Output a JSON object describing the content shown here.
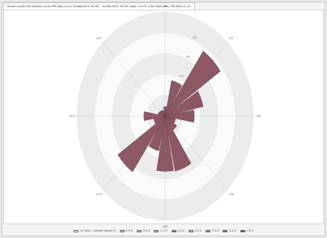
{
  "window": {
    "tab_title": "Rama Lucke Hill, Starke Lucke PM 85p.ca (2) 01/08/2021 00:00 - 01/08/2022 23:59 Cabs: 4.0 Pt, Calc Ftpt Rate, PM 85p.ca (2)"
  },
  "chart_data": {
    "type": "wind-rose",
    "directions_deg": [
      0,
      22.5,
      45,
      67.5,
      90,
      112.5,
      135,
      157.5,
      180,
      202.5,
      225,
      247.5,
      270,
      292.5,
      315,
      337.5
    ],
    "values": [
      0.9,
      3.5,
      7.6,
      4.4,
      3.3,
      1.2,
      1.6,
      5.4,
      5.3,
      3.4,
      6.5,
      1.3,
      2.4,
      0.8,
      0.7,
      0.6
    ],
    "rmax": 10,
    "rings": [
      2,
      4,
      6,
      8,
      10
    ],
    "ring_labels": [
      {
        "deg": 22.5,
        "text": "2%"
      },
      {
        "deg": 22.5,
        "text": "4%"
      },
      {
        "deg": 22.5,
        "text": "6%"
      },
      {
        "deg": 22.5,
        "text": "8%"
      }
    ],
    "compass_labels": [
      {
        "deg": 0,
        "text": "0"
      },
      {
        "deg": 45,
        "text": "45"
      },
      {
        "deg": 90,
        "text": "90"
      },
      {
        "deg": 135,
        "text": "135"
      },
      {
        "deg": 180,
        "text": "180"
      },
      {
        "deg": 225,
        "text": "225"
      },
      {
        "deg": 270,
        "text": "270"
      },
      {
        "deg": 315,
        "text": "315"
      }
    ],
    "colors": {
      "petal_fill": "#8c5863",
      "petal_stroke": "#6a3e48",
      "ring_fill": "#ececec",
      "ring_gap": "#fafafa",
      "axis": "#c4c4c4"
    },
    "legend": [
      {
        "label": "% Calm - (Values equal 0)",
        "color": "#ffffff"
      },
      {
        "label": "0-0.5",
        "color": "#f2c46e"
      },
      {
        "label": "0.5-1",
        "color": "#f39aa0"
      },
      {
        "label": "1-1.5",
        "color": "#9fc3e6"
      },
      {
        "label": "1.5-2",
        "color": "#4f6fb3"
      },
      {
        "label": "2-2.5",
        "color": "#b9b9b9"
      },
      {
        "label": "2.5-3",
        "color": "#d36a8f"
      },
      {
        "label": "3-3.5",
        "color": "#8c5863"
      },
      {
        "label": ">3.5",
        "color": "#6e3a50"
      }
    ]
  }
}
